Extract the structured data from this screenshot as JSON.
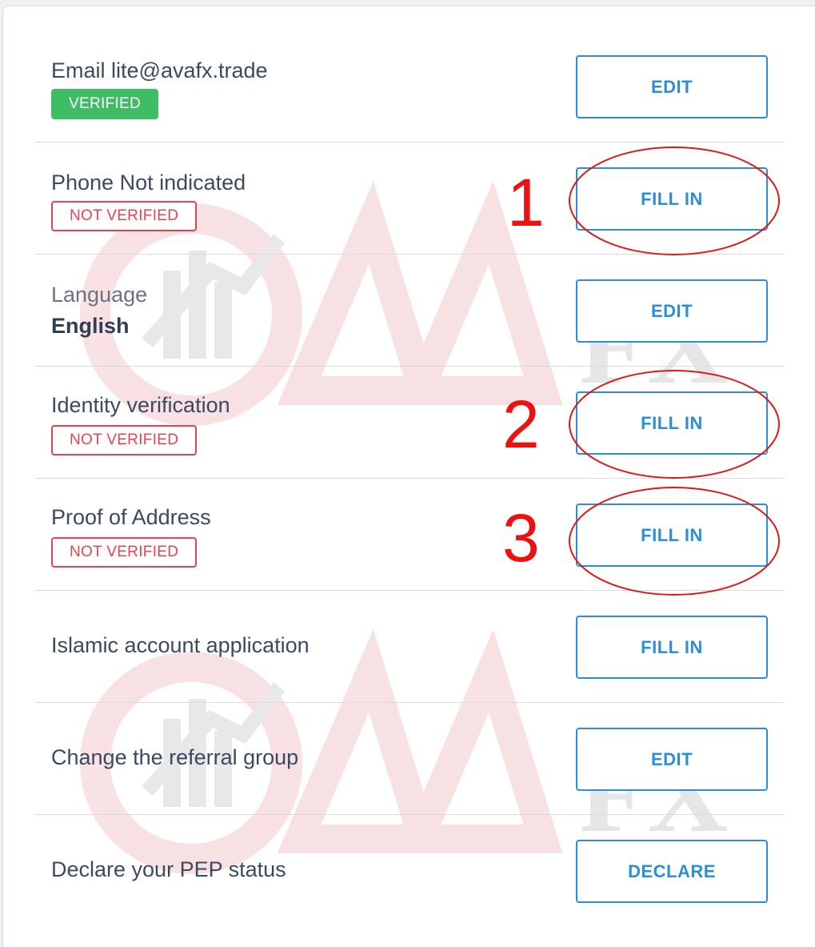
{
  "rows": {
    "email": {
      "label": "Email",
      "value": "lite@avafx.trade",
      "badge": "VERIFIED",
      "button": "EDIT"
    },
    "phone": {
      "label": "Phone",
      "value": "Not indicated",
      "badge": "NOT VERIFIED",
      "button": "FILL IN"
    },
    "language": {
      "label": "Language",
      "value": "English",
      "button": "EDIT"
    },
    "identity": {
      "label": "Identity verification",
      "badge": "NOT VERIFIED",
      "button": "FILL IN"
    },
    "address": {
      "label": "Proof of Address",
      "badge": "NOT VERIFIED",
      "button": "FILL IN"
    },
    "islamic": {
      "label": "Islamic account application",
      "button": "FILL IN"
    },
    "referral": {
      "label": "Change the referral group",
      "button": "EDIT"
    },
    "pep": {
      "label": "Declare your PEP status",
      "button": "DECLARE"
    }
  },
  "annotations": [
    "1",
    "2",
    "3"
  ],
  "watermark": {
    "text": "FX"
  },
  "colors": {
    "accent": "#2b8fd6",
    "verified": "#3fbd64",
    "not_verified": "#e8434f",
    "annotation": "#ee1111"
  },
  "icons": {
    "watermark_logo": "avafx-logo-watermark"
  }
}
